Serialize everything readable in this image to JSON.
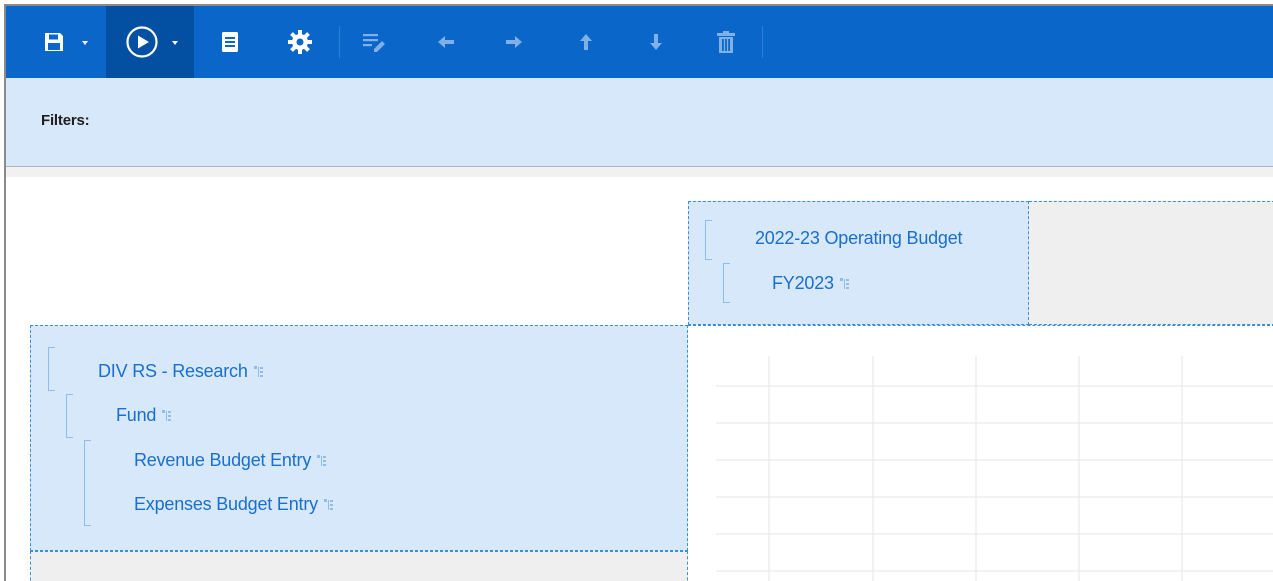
{
  "toolbar": {
    "buttons": [
      {
        "name": "save",
        "icon": "floppy-disk-icon",
        "has_dropdown": true,
        "enabled": true
      },
      {
        "name": "run",
        "icon": "play-circle-icon",
        "has_dropdown": true,
        "enabled": true,
        "active": true
      },
      {
        "name": "document",
        "icon": "document-icon",
        "has_dropdown": false,
        "enabled": true
      },
      {
        "name": "settings",
        "icon": "gear-icon",
        "has_dropdown": false,
        "enabled": true
      },
      {
        "name": "edit",
        "icon": "edit-lines-icon",
        "enabled": false
      },
      {
        "name": "move-left",
        "icon": "arrow-left-icon",
        "enabled": false
      },
      {
        "name": "move-right",
        "icon": "arrow-right-icon",
        "enabled": false
      },
      {
        "name": "move-up",
        "icon": "arrow-up-icon",
        "enabled": false
      },
      {
        "name": "move-down",
        "icon": "arrow-down-icon",
        "enabled": false
      },
      {
        "name": "delete",
        "icon": "trash-icon",
        "enabled": false
      }
    ],
    "colors": {
      "background": "#0a66c8",
      "active": "#0350a2",
      "icon": "#ffffff",
      "icon_disabled": "#7fb0e6"
    }
  },
  "filters": {
    "label": "Filters:"
  },
  "columns": {
    "members": [
      {
        "label": "2022-23 Operating Budget",
        "has_hierarchy_icon": false
      },
      {
        "label": "FY2023",
        "has_hierarchy_icon": true
      }
    ]
  },
  "rows": {
    "members": [
      {
        "label": "DIV RS - Research",
        "has_hierarchy_icon": true
      },
      {
        "label": "Fund",
        "has_hierarchy_icon": true
      },
      {
        "label": "Revenue Budget Entry",
        "has_hierarchy_icon": true
      },
      {
        "label": "Expenses Budget Entry",
        "has_hierarchy_icon": true
      }
    ]
  },
  "colors": {
    "zone_fill": "#d6e8f9",
    "member_text": "#1a6fcf",
    "dashed_border": "#3b8fd8",
    "empty_zone": "#efeff0"
  }
}
